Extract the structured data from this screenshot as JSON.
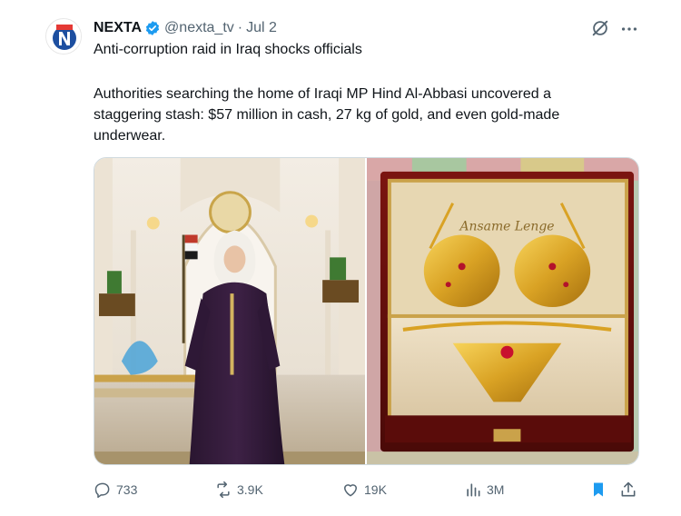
{
  "author": {
    "name": "NEXTA",
    "handle": "@nexta_tv",
    "separator": "·",
    "date": "Jul 2",
    "avatar_icon": "nexta-logo-icon",
    "verified_icon": "verified-badge-icon"
  },
  "tweet": {
    "headline": "Anti-corruption raid in Iraq shocks officials",
    "body_line1": "Authorities searching the home of Iraqi MP Hind Al-Abbasi uncovered a",
    "body_line2": "staggering stash: $57 million in cash, 27 kg of gold, and even gold-made",
    "body_line3": "underwear."
  },
  "media": {
    "left_image_alt": "woman-in-palace-hall",
    "right_image_alt": "gold-lingerie-in-red-box",
    "box_lid_text": "Ansame Lenge"
  },
  "actions": {
    "replies": "733",
    "reposts": "3.9K",
    "likes": "19K",
    "views": "3M"
  },
  "colors": {
    "text": "#0f1419",
    "secondary": "#536471",
    "accent": "#1d9bf0",
    "bookmark_active": "#1d9bf0"
  }
}
